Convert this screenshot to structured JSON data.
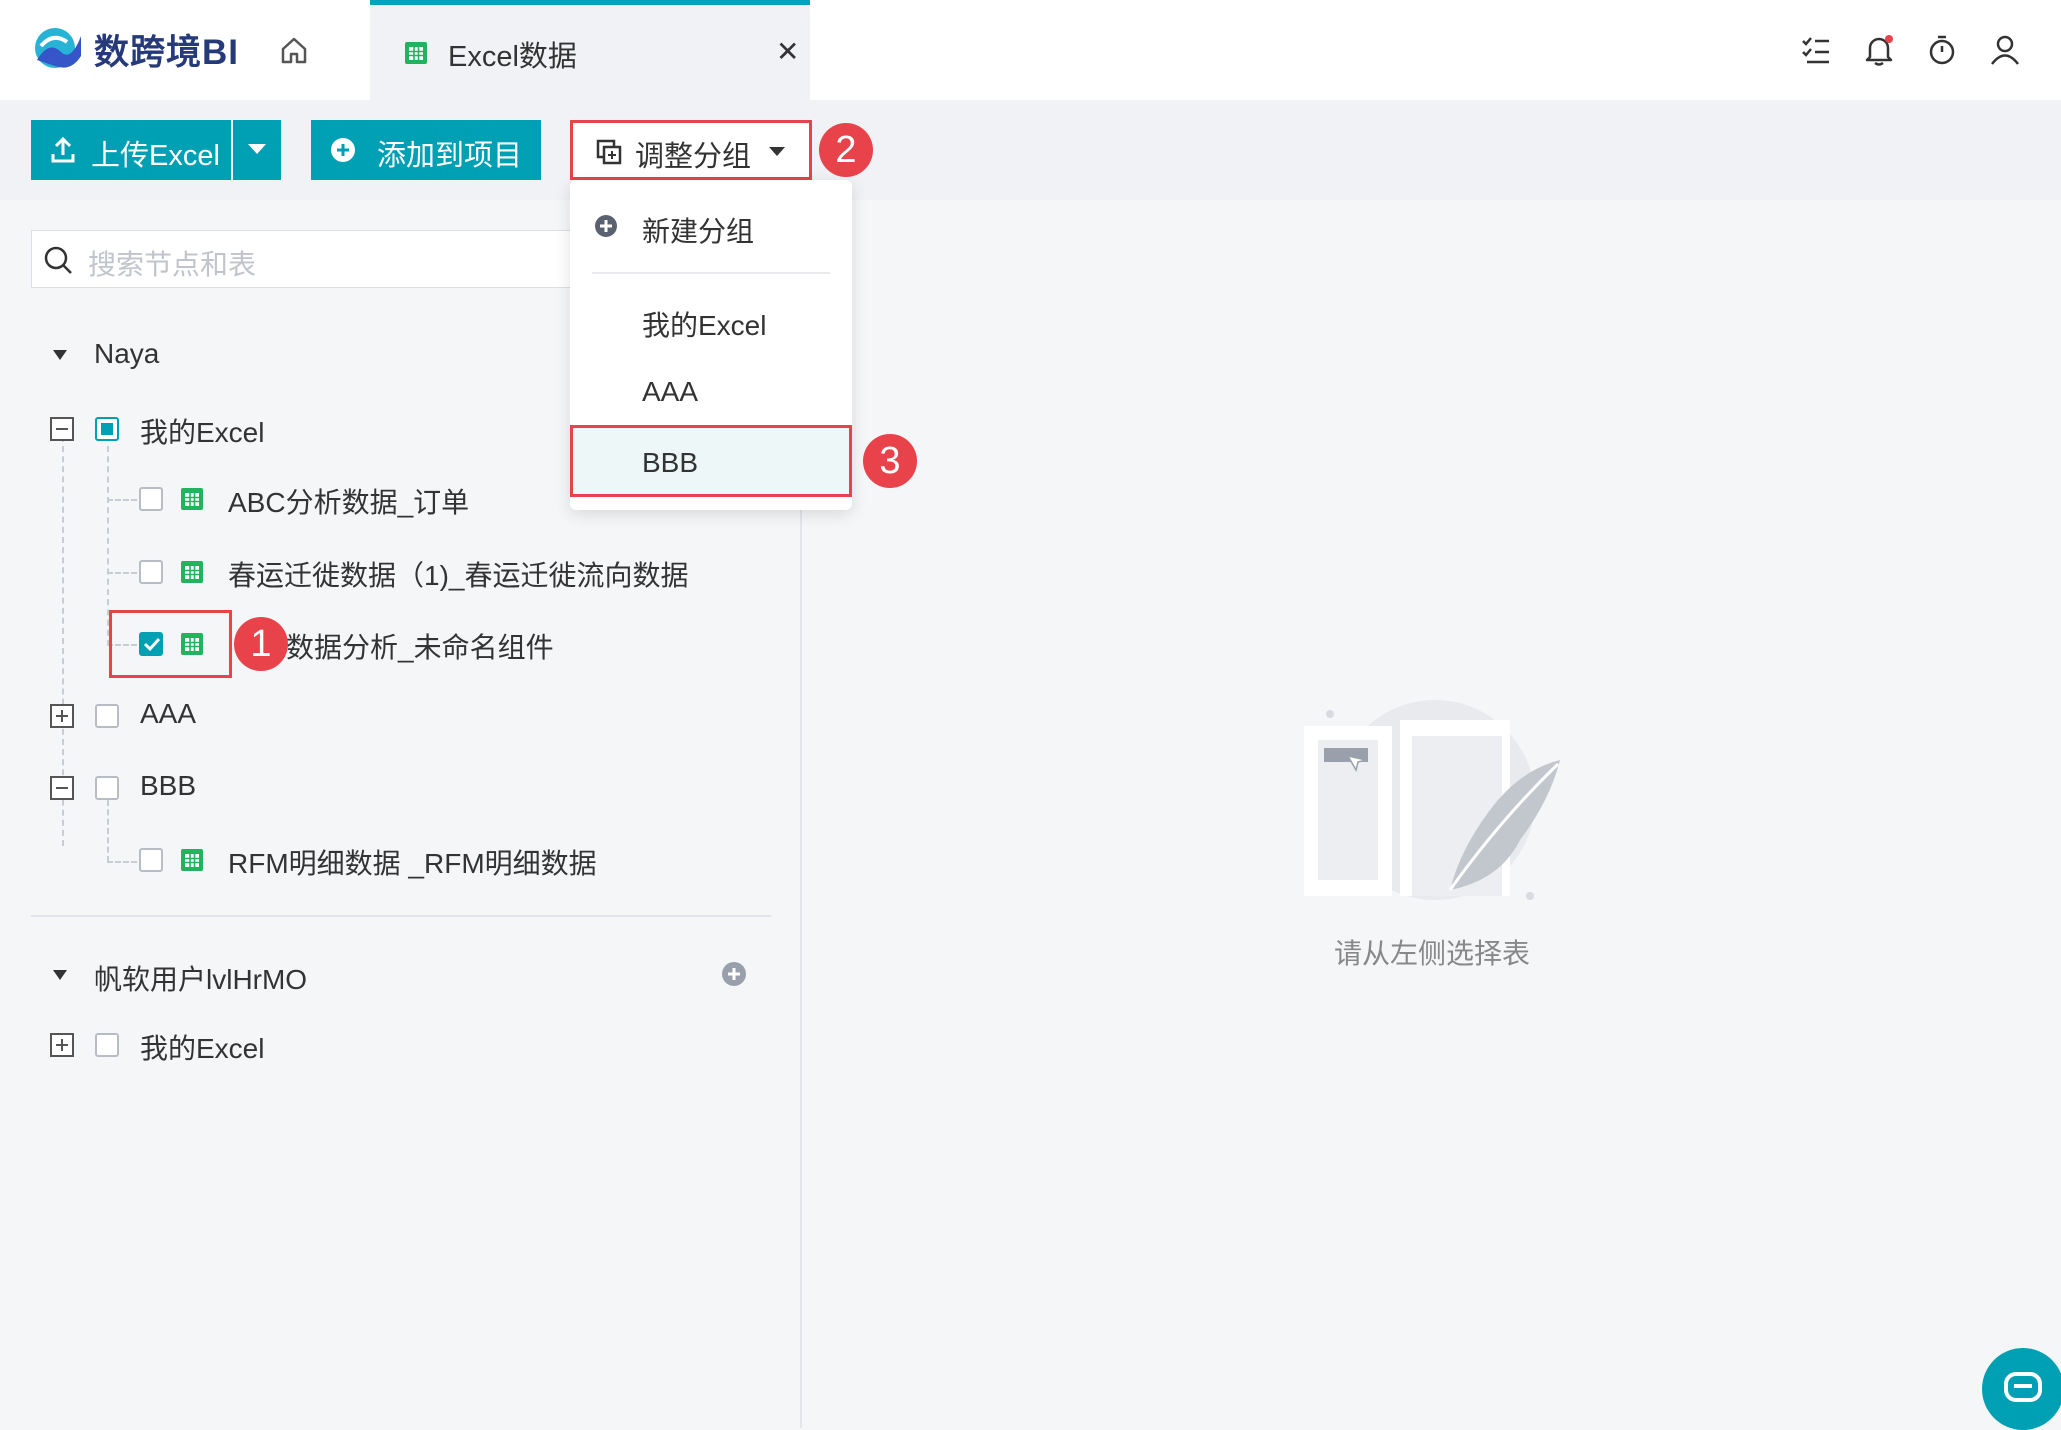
{
  "app": {
    "logo_text": "数跨境BI"
  },
  "tabs": [
    {
      "label": "Excel数据",
      "close": "✕"
    }
  ],
  "top_icons": [
    "task-list-icon",
    "bell-icon",
    "timer-icon",
    "user-icon"
  ],
  "toolbar": {
    "upload_label": "上传Excel",
    "add_to_project_label": "添加到项目",
    "adjust_group_label": "调整分组"
  },
  "search": {
    "placeholder": "搜索节点和表"
  },
  "tree": {
    "owner1": "Naya",
    "group_my_excel": "我的Excel",
    "item_abc": "ABC分析数据_订单",
    "item_spring": "春运迁徙数据（1)_春运迁徙流向数据",
    "item_third_visible": "数据分析_未命名组件",
    "group_aaa": "AAA",
    "group_bbb": "BBB",
    "item_rfm": "RFM明细数据 _RFM明细数据",
    "owner2": "帆软用户lvlHrMO",
    "group_my_excel_2": "我的Excel"
  },
  "dropdown": {
    "new_group": "新建分组",
    "items": [
      "我的Excel",
      "AAA",
      "BBB"
    ]
  },
  "markers": [
    "1",
    "2",
    "3"
  ],
  "empty_state": {
    "text": "请从左侧选择表"
  },
  "colors": {
    "accent": "#00a0b4",
    "highlight": "#e8424a",
    "logo": "#263a7a"
  }
}
